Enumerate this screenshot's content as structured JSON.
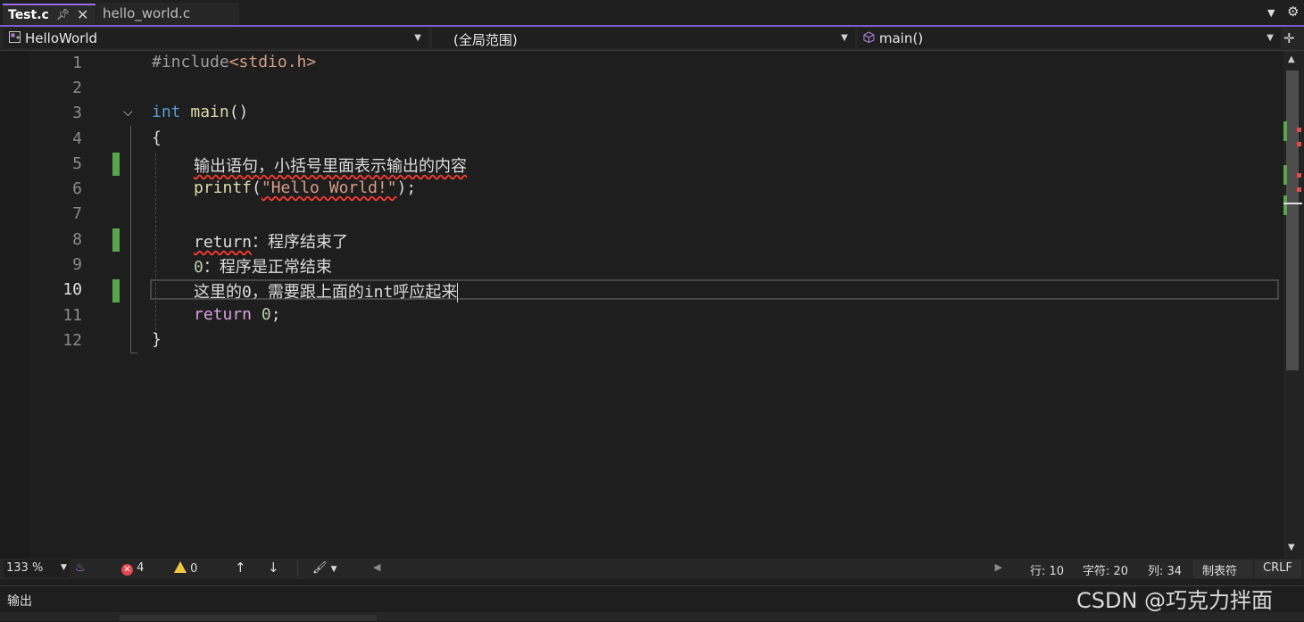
{
  "tabs": [
    {
      "label": "Test.c",
      "active": true
    },
    {
      "label": "hello_world.c",
      "active": false
    }
  ],
  "tab_icons": {
    "pin": "pin-icon",
    "close": "close-icon",
    "overflow": "chevron-down-icon",
    "settings": "gear-icon"
  },
  "navbar": {
    "project": "HelloWorld",
    "scope": "(全局范围)",
    "member": "main()"
  },
  "editor": {
    "lines": [
      {
        "n": "1"
      },
      {
        "n": "2"
      },
      {
        "n": "3"
      },
      {
        "n": "4"
      },
      {
        "n": "5"
      },
      {
        "n": "6"
      },
      {
        "n": "7"
      },
      {
        "n": "8"
      },
      {
        "n": "9"
      },
      {
        "n": "10"
      },
      {
        "n": "11"
      },
      {
        "n": "12"
      }
    ],
    "current_line": 10,
    "changed_lines": [
      5,
      8,
      10
    ],
    "code": {
      "l1_directive": "#include",
      "l1_header": "<stdio.h>",
      "l3_type": "int",
      "l3_name": "main",
      "l3_parens": "()",
      "l4": "{",
      "l5": "输出语句，小括号里面表示输出的内容",
      "l6_fn": "printf",
      "l6_open": "(",
      "l6_str": "\"Hello World!\"",
      "l6_close": ");",
      "l8_kw": "return",
      "l8_rest": "：程序结束了",
      "l9_num": "0",
      "l9_rest": "：程序是正常结束",
      "l10": "这里的0，需要跟上面的int呼应起来",
      "l11_kw": "return",
      "l11_num": "0",
      "l11_end": ";",
      "l12": "}"
    }
  },
  "status": {
    "zoom": "133 %",
    "errors": "4",
    "warnings": "0",
    "line": "行: 10",
    "char": "字符: 20",
    "col": "列: 34",
    "indent": "制表符",
    "eol": "CRLF"
  },
  "output": {
    "title": "输出"
  },
  "watermark": "CSDN @巧克力拌面",
  "colors": {
    "accent": "#7b5ad0",
    "change": "#57a64a",
    "error": "#e5484d",
    "warning": "#f2c744"
  }
}
